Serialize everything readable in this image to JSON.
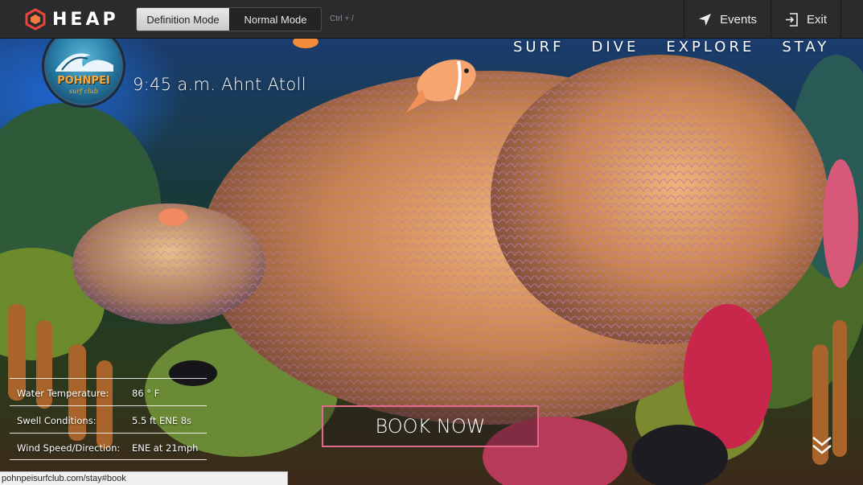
{
  "toolbar": {
    "brand": "HEAP",
    "modes": [
      "Definition Mode",
      "Normal Mode"
    ],
    "active_mode": "Definition Mode",
    "shortcut": "Ctrl + /",
    "events_label": "Events",
    "exit_label": "Exit"
  },
  "site": {
    "logo": {
      "name": "POHNPEI",
      "sub": "surf club"
    },
    "time_location": "9:45 a.m. Ahnt Atoll",
    "nav": [
      "SURF",
      "DIVE",
      "EXPLORE",
      "STAY"
    ],
    "conditions": [
      {
        "label": "Water Temperature:",
        "value": "86 ° F"
      },
      {
        "label": "Swell Conditions:",
        "value": "5.5 ft ENE 8s"
      },
      {
        "label": "Wind Speed/Direction:",
        "value": "ENE at 21mph"
      }
    ],
    "book_button": "BOOK NOW"
  },
  "status_url": "pohnpeisurfclub.com/stay#book",
  "colors": {
    "toolbar_bg": "#2b2b2e",
    "heap_accent": "#e8453c",
    "book_border": "#e46a8b",
    "anemone": "#d9955a"
  }
}
